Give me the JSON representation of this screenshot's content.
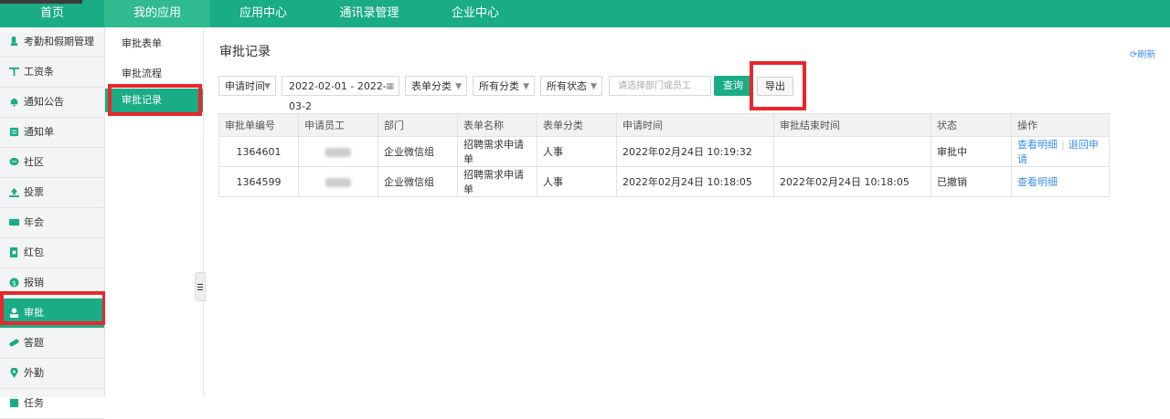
{
  "topnav": [
    {
      "label": "首页",
      "active": false
    },
    {
      "label": "我的应用",
      "active": true
    },
    {
      "label": "应用中心",
      "active": false
    },
    {
      "label": "通讯录管理",
      "active": false
    },
    {
      "label": "企业中心",
      "active": false
    }
  ],
  "sidebar": [
    {
      "label": "考勤和假期管理",
      "icon": "clock-icon"
    },
    {
      "label": "工资条",
      "icon": "salary-icon"
    },
    {
      "label": "通知公告",
      "icon": "bell-icon"
    },
    {
      "label": "通知单",
      "icon": "notice-icon"
    },
    {
      "label": "社区",
      "icon": "chat-icon"
    },
    {
      "label": "投票",
      "icon": "vote-icon"
    },
    {
      "label": "年会",
      "icon": "flag-icon"
    },
    {
      "label": "红包",
      "icon": "redpacket-icon"
    },
    {
      "label": "报销",
      "icon": "coin-icon"
    },
    {
      "label": "审批",
      "icon": "user-icon",
      "active": true
    },
    {
      "label": "答题",
      "icon": "pill-icon"
    },
    {
      "label": "外勤",
      "icon": "location-icon"
    },
    {
      "label": "任务",
      "icon": "task-icon"
    }
  ],
  "subnav": [
    {
      "label": "审批表单"
    },
    {
      "label": "审批流程"
    },
    {
      "label": "审批记录",
      "active": true
    }
  ],
  "page": {
    "title": "审批记录",
    "refresh": "刷新"
  },
  "filters": {
    "time_type": "申请时间",
    "date_range": "2022-02-01 - 2022-03-2",
    "form_category": "表单分类",
    "all_category": "所有分类",
    "all_status": "所有状态",
    "search_placeholder": "请选择部门或员工",
    "query_label": "查询",
    "export_label": "导出"
  },
  "table": {
    "headers": [
      "审批单编号",
      "申请员工",
      "部门",
      "表单名称",
      "表单分类",
      "申请时间",
      "审批结束时间",
      "状态",
      "操作"
    ],
    "rows": [
      {
        "id": "1364601",
        "employee": "",
        "dept": "企业微信组",
        "form": "招聘需求申请单",
        "category": "人事",
        "apply_time": "2022年02月24日 10:19:32",
        "end_time": "",
        "status": "审批中",
        "action1": "查看明细",
        "action2": "退回申请"
      },
      {
        "id": "1364599",
        "employee": "",
        "dept": "企业微信组",
        "form": "招聘需求申请单",
        "category": "人事",
        "apply_time": "2022年02月24日 10:18:05",
        "end_time": "2022年02月24日 10:18:05",
        "status": "已撤销",
        "action1": "查看明细",
        "action2": ""
      }
    ]
  },
  "colors": {
    "brand": "#1aac84",
    "highlight": "#e8262c",
    "link": "#3a8ee6"
  }
}
